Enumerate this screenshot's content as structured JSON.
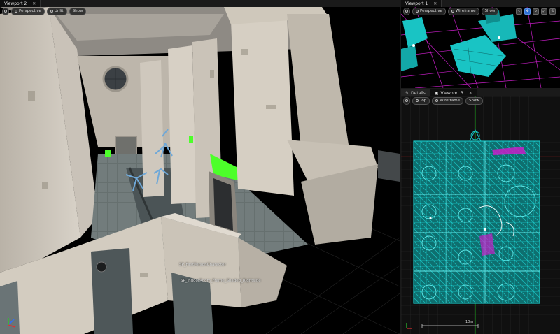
{
  "viewport2": {
    "tab_label": "Viewport 2",
    "toolbar": {
      "view_mode": "Perspective",
      "lit_mode": "Unlit",
      "show_label": "Show"
    },
    "object_labels": [
      "SP_FirstPersonCharacter",
      "SP_IndoorRoom_Frame_Shaded_Rightside"
    ]
  },
  "viewport1": {
    "tab_label": "Viewport 1",
    "toolbar": {
      "view_mode": "Perspective",
      "lit_mode": "Wireframe",
      "show_label": "Show"
    }
  },
  "bottom_right": {
    "tabs": [
      {
        "label": "Details"
      },
      {
        "label": "Viewport 3"
      }
    ],
    "toolbar": {
      "view_mode": "Top",
      "lit_mode": "Wireframe",
      "show_label": "Show"
    },
    "scale_label": "10m"
  },
  "colors": {
    "wire_cyan": "#19c4c4",
    "wire_magenta": "#c81ec8",
    "grid_green": "#1a9a1a",
    "highlight_green": "#4cff2a"
  }
}
